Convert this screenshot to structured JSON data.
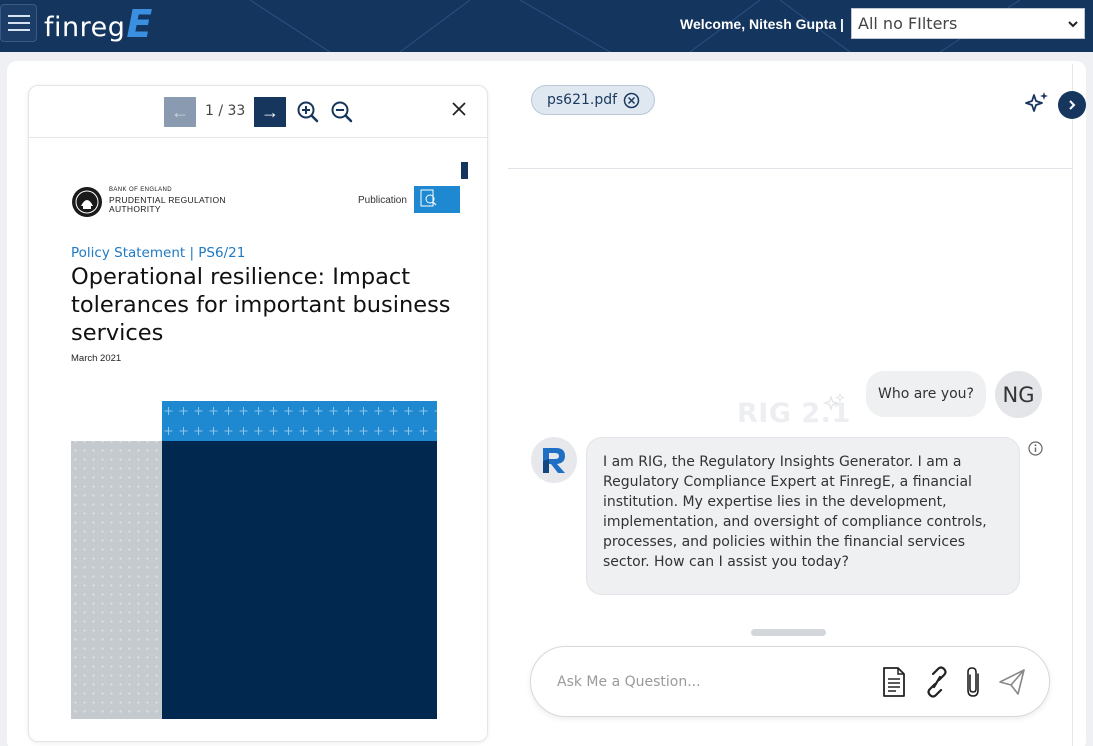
{
  "header": {
    "logo_text": "finreg",
    "logo_accent": "E",
    "welcome": "Welcome, Nitesh Gupta |",
    "filter": {
      "selected": "All no FIlters"
    },
    "colors": {
      "bar": "#14355e",
      "accent": "#3a8fe0"
    }
  },
  "pdf": {
    "page_counter": "1 / 33",
    "prev_label": "←",
    "next_label": "→",
    "document": {
      "org_small": "BANK OF ENGLAND",
      "org_line1": "PRUDENTIAL REGULATION",
      "org_line2": "AUTHORITY",
      "publication_label": "Publication",
      "subtitle": "Policy Statement | PS6/21",
      "title": "Operational resilience: Impact tolerances for important business services",
      "date": "March 2021"
    }
  },
  "chat": {
    "file_chip": "ps621.pdf",
    "watermark": "RIG 2.1",
    "messages": [
      {
        "role": "user",
        "avatar": "NG",
        "text": "Who are you?"
      },
      {
        "role": "bot",
        "avatar": "R",
        "text": "I am RIG, the Regulatory Insights Generator. I am a Regulatory Compliance Expert at FinregE, a financial institution. My expertise lies in the development, implementation, and oversight of compliance controls, processes, and policies within the financial services sector. How can I assist you today?"
      }
    ],
    "input": {
      "placeholder": "Ask Me a Question...",
      "value": ""
    },
    "icons": [
      "document-icon",
      "link-icon",
      "paperclip-icon",
      "send-icon",
      "sparkle-icon"
    ]
  }
}
